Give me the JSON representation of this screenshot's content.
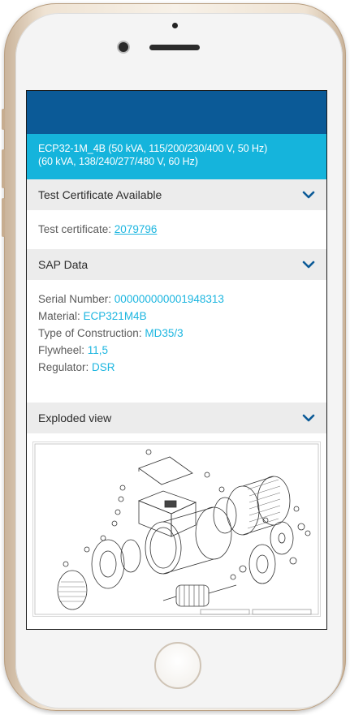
{
  "banner": {
    "line1": "ECP32-1M_4B (50 kVA, 115/200/230/400 V, 50 Hz)",
    "line2": "(60 kVA, 138/240/277/480 V, 60 Hz)"
  },
  "sections": {
    "certificate": {
      "title": "Test Certificate Available",
      "label": "Test certificate: ",
      "link": "2079796"
    },
    "sap": {
      "title": "SAP Data",
      "rows": [
        {
          "label": "Serial Number: ",
          "value": "000000000001948313"
        },
        {
          "label": "Material: ",
          "value": "ECP321M4B"
        },
        {
          "label": "Type of Construction: ",
          "value": "MD35/3"
        },
        {
          "label": "Flywheel: ",
          "value": "11,5"
        },
        {
          "label": "Regulator: ",
          "value": "DSR"
        }
      ]
    },
    "exploded": {
      "title": "Exploded view"
    }
  },
  "icons": {
    "chevron": "chevron-down-icon"
  },
  "colors": {
    "app_bar": "#0b5a97",
    "banner": "#15b4dc",
    "accent": "#1db6e0",
    "chevron": "#0b5a97"
  }
}
